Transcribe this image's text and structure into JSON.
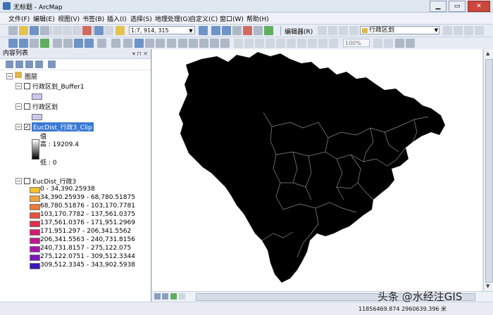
{
  "window": {
    "title": "无标题 - ArcMap"
  },
  "menu": {
    "items": [
      "文件(F)",
      "编辑(E)",
      "视图(V)",
      "书签(B)",
      "插入(I)",
      "选择(S)",
      "地理处理(G)",
      "自定义(C)",
      "窗口(W)",
      "帮助(H)"
    ]
  },
  "toolbar": {
    "scale": "1:7, 914, 315",
    "editor_label": "编辑器(R)",
    "target_layer": "行政区划",
    "zoom_percent": "100%"
  },
  "toc": {
    "title": "内容列表",
    "root_group": "图层",
    "layers": [
      {
        "name": "行政区划_Buffer1",
        "checked": false,
        "swatch_color": "#c9c9ef"
      },
      {
        "name": "行政区划",
        "checked": false,
        "swatch_color": "#c9c9ef"
      },
      {
        "name": "EucDist_行政3_Clip",
        "checked": true,
        "value_label": "值",
        "high_label": "高 : 19209.4",
        "low_label": "低 : 0"
      },
      {
        "name": "EucDist_行政3",
        "checked": false,
        "classes": [
          {
            "label": "0 - 34,390.25938",
            "color": "#f2c12e"
          },
          {
            "label": "34,390.25939 - 68,780.51875",
            "color": "#f0a33a"
          },
          {
            "label": "68,780.51876 - 103,170.7781",
            "color": "#ec7a3b"
          },
          {
            "label": "103,170.7782 - 137,561.0375",
            "color": "#e5513c"
          },
          {
            "label": "137,561.0376 - 171,951.2969",
            "color": "#dd2f4e"
          },
          {
            "label": "171,951.297 - 206,341.5562",
            "color": "#d21a6e"
          },
          {
            "label": "206,341.5563 - 240,731.8156",
            "color": "#c0188e"
          },
          {
            "label": "240,731.8157 - 275,122.075",
            "color": "#a516a8"
          },
          {
            "label": "275,122.0751 - 309,512.3344",
            "color": "#7b16bd"
          },
          {
            "label": "309,512.3345 - 343,902.5938",
            "color": "#3a16b8"
          }
        ]
      }
    ]
  },
  "status": {
    "coordinates": "11856469.874  2960639.396 米"
  },
  "watermark": "头条 @水经注GIS"
}
